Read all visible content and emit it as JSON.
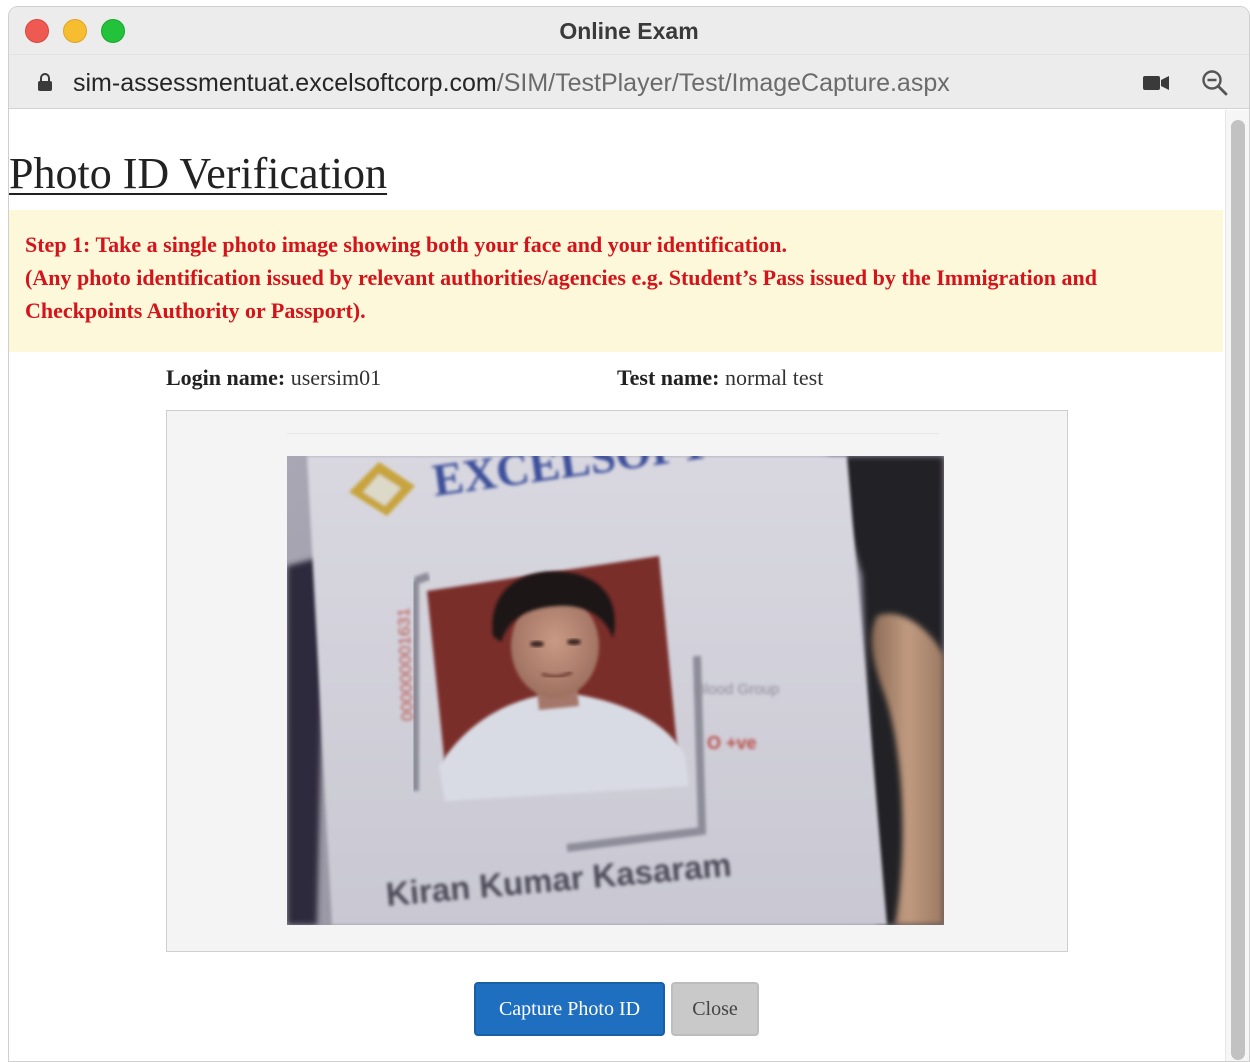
{
  "window": {
    "title": "Online Exam"
  },
  "address_bar": {
    "url_host": "sim-assessmentuat.excelsoftcorp.com",
    "url_path": "/SIM/TestPlayer/Test/ImageCapture.aspx",
    "icons": [
      "lock-icon",
      "camera-icon",
      "zoom-out-icon"
    ]
  },
  "page": {
    "title": "Photo ID Verification",
    "instructions": {
      "line1": "Step 1: Take a single photo image showing both your face and your identification.",
      "line2": "(Any photo identification issued by relevant authorities/agencies e.g. Student’s Pass issued by the Immigration and Checkpoints Authority or Passport)."
    },
    "login": {
      "label": "Login name:",
      "value": "usersim01"
    },
    "test": {
      "label": "Test name:",
      "value": "normal test"
    },
    "camera_preview": {
      "id_card_logo_text": "EXCELSOFT",
      "id_number": "000000001631",
      "blood_group_label": "Blood Group",
      "blood_group_value": "O +ve",
      "card_holder_name": "Kiran Kumar Kasaram"
    },
    "buttons": {
      "capture": "Capture Photo ID",
      "close": "Close"
    }
  },
  "colors": {
    "instruction_text": "#d4131b",
    "instruction_background": "#fdf8d9",
    "capture_button": "#1f6fc1",
    "close_button": "#c9c9c9"
  }
}
